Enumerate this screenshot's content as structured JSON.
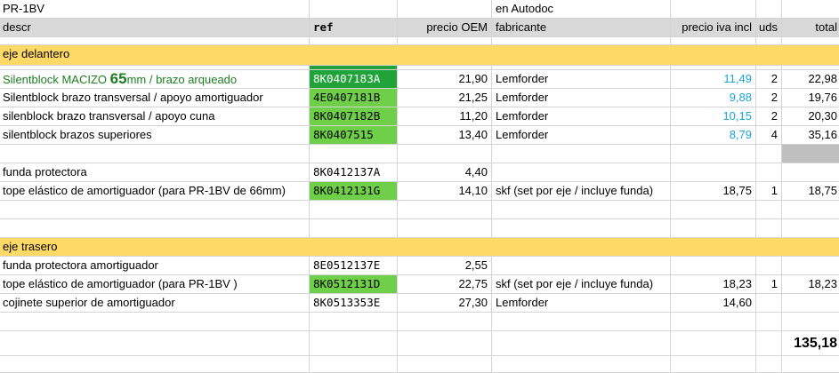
{
  "title_row": {
    "model": "PR-1BV",
    "source": "en Autodoc"
  },
  "headers": {
    "descr": "descr",
    "ref": "ref",
    "precio_oem": "precio OEM",
    "fabricante": "fabricante",
    "precio_iva": "precio iva incl",
    "uds": "uds",
    "total": "total"
  },
  "sections": {
    "front": "eje delantero",
    "rear": "eje trasero"
  },
  "front_rows": [
    {
      "descr_pre": "Silentblock MACIZO ",
      "descr_big": "65",
      "descr_post": "mm / brazo arqueado",
      "ref": "8K0407183A",
      "oem": "21,90",
      "fab": "Lemforder",
      "iva": "11,49",
      "uds": "2",
      "total": "22,98"
    },
    {
      "descr": "Silentblock brazo transversal / apoyo amortiguador",
      "ref": "4E0407181B",
      "oem": "21,25",
      "fab": "Lemforder",
      "iva": "9,88",
      "uds": "2",
      "total": "19,76"
    },
    {
      "descr": "silenblock brazo transversal / apoyo cuna",
      "ref": "8K0407182B",
      "oem": "11,20",
      "fab": "Lemforder",
      "iva": "10,15",
      "uds": "2",
      "total": "20,30"
    },
    {
      "descr": "silentblock brazos superiores",
      "ref": "8K0407515",
      "oem": "13,40",
      "fab": "Lemforder",
      "iva": "8,79",
      "uds": "4",
      "total": "35,16"
    }
  ],
  "mid_rows": [
    {
      "descr": "funda protectora",
      "ref": "8K0412137A",
      "oem": "4,40",
      "fab": "",
      "iva": "",
      "uds": "",
      "total": ""
    },
    {
      "descr": "tope elástico de amortiguador (para PR-1BV de 66mm)",
      "ref": "8K0412131G",
      "oem": "14,10",
      "fab": "skf (set por eje / incluye funda)",
      "iva": "18,75",
      "uds": "1",
      "total": "18,75"
    }
  ],
  "rear_rows": [
    {
      "descr": "funda protectora amortiguador",
      "ref": "8E0512137E",
      "oem": "2,55",
      "fab": "",
      "iva": "",
      "uds": "",
      "total": ""
    },
    {
      "descr": "tope elástico de amortiguador (para PR-1BV )",
      "ref": "8K0512131D",
      "oem": "22,75",
      "fab": "skf (set por eje / incluye funda)",
      "iva": "18,23",
      "uds": "1",
      "total": "18,23"
    },
    {
      "descr": "cojinete superior de amortiguador",
      "ref": "8K0513353E",
      "oem": "27,30",
      "fab": "Lemforder",
      "iva": "14,60",
      "uds": "",
      "total": ""
    }
  ],
  "grand_total": "135,18"
}
